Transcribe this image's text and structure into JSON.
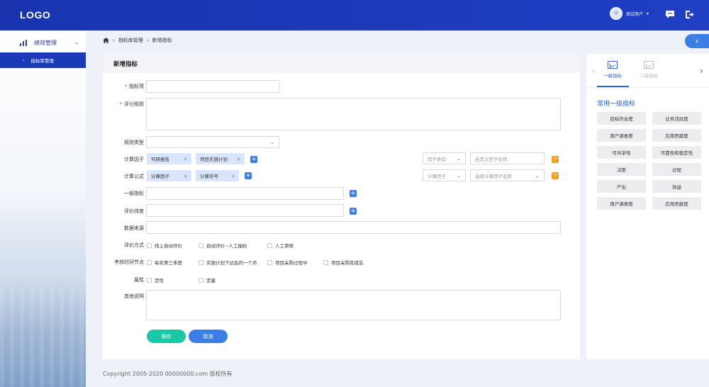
{
  "header": {
    "logo": "LOGO",
    "user_name": "测试用户",
    "caret": "▾",
    "message_icon": "chat-bubble-icon",
    "logout_icon": "logout-icon"
  },
  "sidebar": {
    "group_label": "绩效管理",
    "chevron": "⌄",
    "items": [
      {
        "label": "指标库管理",
        "arrow": "›"
      }
    ]
  },
  "breadcrumb": {
    "home_icon": "home-icon",
    "sep": "›",
    "items": [
      "指标库管理",
      "新增指标"
    ]
  },
  "expand_button": "›",
  "form": {
    "title": "新增指标",
    "labels": {
      "indicator_item": "指标项",
      "scoring_rule": "评分规则",
      "rule_type": "规则类型",
      "calc_factor": "计算因子",
      "calc_formula": "计算公式",
      "level1": "一级指标",
      "dimension": "评价纬度",
      "data_source": "数据来源",
      "eval_method": "评价方式",
      "assess_time": "考核时间节点",
      "attribute": "属性",
      "other": "其他说明"
    },
    "factor_tags": [
      "可研报告",
      "项目实施计划"
    ],
    "formula_tags": [
      "计算因子",
      "计算符号"
    ],
    "tag_close": "×",
    "plus": "+",
    "minus": "−",
    "dropdown_arrow": "⌄",
    "factor_type_placeholder": "因子类型",
    "custom_factor_placeholder": "自定义因子名称",
    "calc_factor_placeholder": "计算因子",
    "select_factor_placeholder": "选择计算因子名称",
    "eval_methods": [
      "线上自动评价",
      "自动评价~人工抽检",
      "人工审核"
    ],
    "assess_times": [
      "每年第三季度",
      "实施计划下达后的一个月",
      "项目采购过程中",
      "项目采购完成后"
    ],
    "attributes": [
      "定性",
      "定量"
    ],
    "save": "保存",
    "cancel": "取消"
  },
  "right_panel": {
    "tabs": [
      "一级指标",
      "二级指标"
    ],
    "nav_prev": "‹",
    "nav_next": "›",
    "title": "常用一级指标",
    "chips": [
      "目标符合度",
      "业务活跃度",
      "用户满意度",
      "应用贡献度",
      "可共享性",
      "可靠性和稳定性",
      "决策",
      "过程",
      "产出",
      "效益",
      "用户满意度",
      "应用贡献度"
    ]
  },
  "footer": "Copyright 2005-2020 00000000.com 版权所有",
  "colors": {
    "header": "#1f3fc4",
    "accent": "#2b60d8",
    "save": "#1cc7a6",
    "cancel": "#3a7ee6",
    "required": "#e23b3b",
    "minus": "#f0a12a"
  }
}
